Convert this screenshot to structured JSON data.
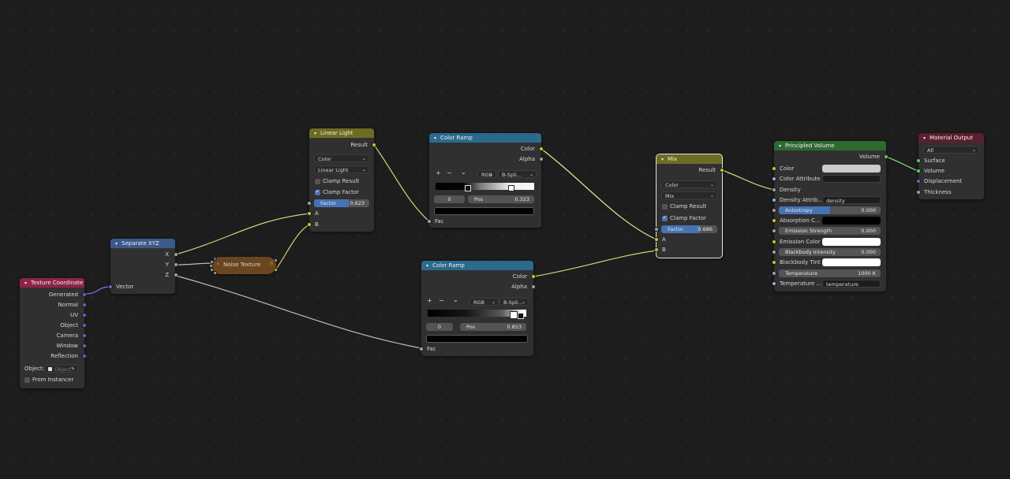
{
  "nodes": {
    "texture_coordinate": {
      "title": "Texture Coordinate",
      "outputs": [
        "Generated",
        "Normal",
        "UV",
        "Object",
        "Camera",
        "Window",
        "Reflection"
      ],
      "object_label": "Object:",
      "object_placeholder": "Object",
      "from_instancer": "From Instancer"
    },
    "separate_xyz": {
      "title": "Separate XYZ",
      "outputs": [
        "X",
        "Y",
        "Z"
      ],
      "input": "Vector"
    },
    "noise_texture": {
      "title": "Noise Texture"
    },
    "linear_light": {
      "title": "Linear Light",
      "output": "Result",
      "data_type": "Color",
      "blend_mode": "Linear Light",
      "clamp_result": "Clamp Result",
      "clamp_result_checked": false,
      "clamp_factor": "Clamp Factor",
      "clamp_factor_checked": true,
      "factor_label": "Factor",
      "factor_value": "0.623",
      "inputs": [
        "A",
        "B"
      ]
    },
    "color_ramp_1": {
      "title": "Color Ramp",
      "outputs": [
        "Color",
        "Alpha"
      ],
      "color_mode": "RGB",
      "interpolation": "B-Spli...",
      "stop_index": "0",
      "pos_label": "Pos",
      "pos_value": "0.323",
      "input": "Fac"
    },
    "color_ramp_2": {
      "title": "Color Ramp",
      "outputs": [
        "Color",
        "Alpha"
      ],
      "color_mode": "RGB",
      "interpolation": "B-Spli...",
      "stop_index": "0",
      "pos_label": "Pos",
      "pos_value": "0.853",
      "input": "Fac"
    },
    "mix": {
      "title": "Mix",
      "output": "Result",
      "data_type": "Color",
      "blend_mode": "Mix",
      "clamp_result": "Clamp Result",
      "clamp_result_checked": false,
      "clamp_factor": "Clamp Factor",
      "clamp_factor_checked": true,
      "factor_label": "Factor",
      "factor_value": "0.686",
      "inputs": [
        "A",
        "B"
      ]
    },
    "principled_volume": {
      "title": "Principled Volume",
      "output": "Volume",
      "color": "Color",
      "color_attribute": "Color Attribute",
      "density": "Density",
      "density_attribute": "Density Attrib...",
      "density_attribute_value": "density",
      "anisotropy_label": "Anisotropy",
      "anisotropy_value": "0.000",
      "absorption_color": "Absorption C...",
      "emission_strength_label": "Emission Strength",
      "emission_strength_value": "0.000",
      "emission_color": "Emission Color",
      "blackbody_intensity_label": "Blackbody Intensity",
      "blackbody_intensity_value": "0.000",
      "blackbody_tint": "Blackbody Tint",
      "temperature_label": "Temperature",
      "temperature_value": "1000 K",
      "temperature_attribute": "Temperature ...",
      "temperature_attribute_value": "temperature"
    },
    "material_output": {
      "title": "Material Output",
      "target": "All",
      "inputs": [
        "Surface",
        "Volume",
        "Displacement",
        "Thickness"
      ]
    }
  },
  "colors": {
    "input_header": "#8e2348",
    "vector_header": "#3b5a8a",
    "converter_header": "#2a6a8c",
    "texture_header": "#6a4620",
    "color_header": "#6c6c23",
    "shader_header": "#2e6a2e",
    "output_header": "#5c1f2e",
    "link": "#c8c8c8",
    "link_color": "#c7c729",
    "socket_color": "#c7c729",
    "socket_float": "#a1a1a1",
    "socket_vector": "#6363c7",
    "socket_shader": "#63c763",
    "accent_blue": "#4772b3"
  },
  "icons": {
    "add": "+",
    "remove": "−",
    "menu": "chevron-down",
    "eyedropper": "eyedropper-icon",
    "collapse": "chevron-down-icon"
  }
}
